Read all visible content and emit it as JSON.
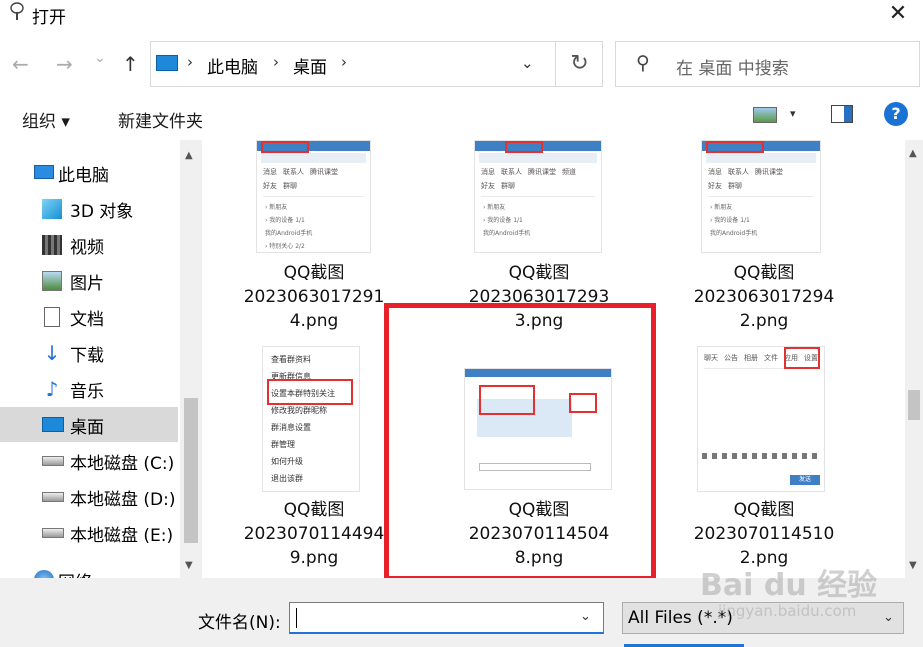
{
  "window": {
    "title": "打开",
    "close_glyph": "✕"
  },
  "nav": {
    "back_glyph": "←",
    "forward_glyph": "→",
    "history_glyph": "⌄",
    "up_glyph": "↑"
  },
  "address": {
    "crumbs": [
      "此电脑",
      "桌面"
    ],
    "separator": "›",
    "dropdown_glyph": "⌄",
    "refresh_glyph": "↻"
  },
  "search": {
    "placeholder": "在 桌面 中搜索",
    "icon_glyph": "⚲"
  },
  "toolbar": {
    "organize": "组织 ▾",
    "new_folder": "新建文件夹",
    "view_dropdown": "▾",
    "help": "?"
  },
  "sidebar": {
    "items": [
      {
        "label": "此电脑",
        "icon": "computer-icon"
      },
      {
        "label": "3D 对象",
        "icon": "3d-objects-icon"
      },
      {
        "label": "视频",
        "icon": "video-icon"
      },
      {
        "label": "图片",
        "icon": "pictures-icon"
      },
      {
        "label": "文档",
        "icon": "documents-icon"
      },
      {
        "label": "下载",
        "icon": "download-icon",
        "glyph": "↓"
      },
      {
        "label": "音乐",
        "icon": "music-icon",
        "glyph": "♪"
      },
      {
        "label": "桌面",
        "icon": "desktop-icon",
        "selected": true
      },
      {
        "label": "本地磁盘 (C:)",
        "icon": "drive-icon"
      },
      {
        "label": "本地磁盘 (D:)",
        "icon": "drive-icon"
      },
      {
        "label": "本地磁盘 (E:)",
        "icon": "drive-icon"
      },
      {
        "label": "网络",
        "icon": "network-icon"
      }
    ],
    "scroll_up": "▲",
    "scroll_down": "▼"
  },
  "files": [
    {
      "line1": "QQ截图",
      "line2": "2023063017291",
      "line3": "4.png"
    },
    {
      "line1": "QQ截图",
      "line2": "2023063017293",
      "line3": "3.png"
    },
    {
      "line1": "QQ截图",
      "line2": "2023063017294",
      "line3": "2.png"
    },
    {
      "line1": "QQ截图",
      "line2": "2023070114494",
      "line3": "9.png"
    },
    {
      "line1": "QQ截图",
      "line2": "2023070114504",
      "line3": "8.png",
      "highlighted": true
    },
    {
      "line1": "QQ截图",
      "line2": "2023070114510",
      "line3": "2.png"
    }
  ],
  "thumb_text": {
    "qq_tabs": [
      "消息",
      "联系人",
      "腾讯课堂",
      "频道"
    ],
    "qq_sub": [
      "好友",
      "群聊"
    ],
    "qq_rows": [
      "› 新朋友",
      "› 我的设备 1/1",
      "我的Android手机",
      "› 特别关心 2/2"
    ],
    "menu_items": [
      "查看群资料",
      "更新群信息",
      "设置本群特别关注",
      "修改我的群昵称",
      "群消息设置",
      "群管理",
      "如何升级",
      "退出该群"
    ],
    "chat_tabs": [
      "聊天",
      "公告",
      "相册",
      "文件",
      "应用",
      "设置"
    ],
    "send_label": "发送"
  },
  "bottom": {
    "filename_label": "文件名(N):",
    "filename_value": "",
    "filename_dd": "⌄",
    "filetype": "All Files (*.*)",
    "filetype_dd": "⌄"
  },
  "watermark": {
    "brand": "Bai du 经验",
    "url": "jingyan.baidu.com"
  }
}
